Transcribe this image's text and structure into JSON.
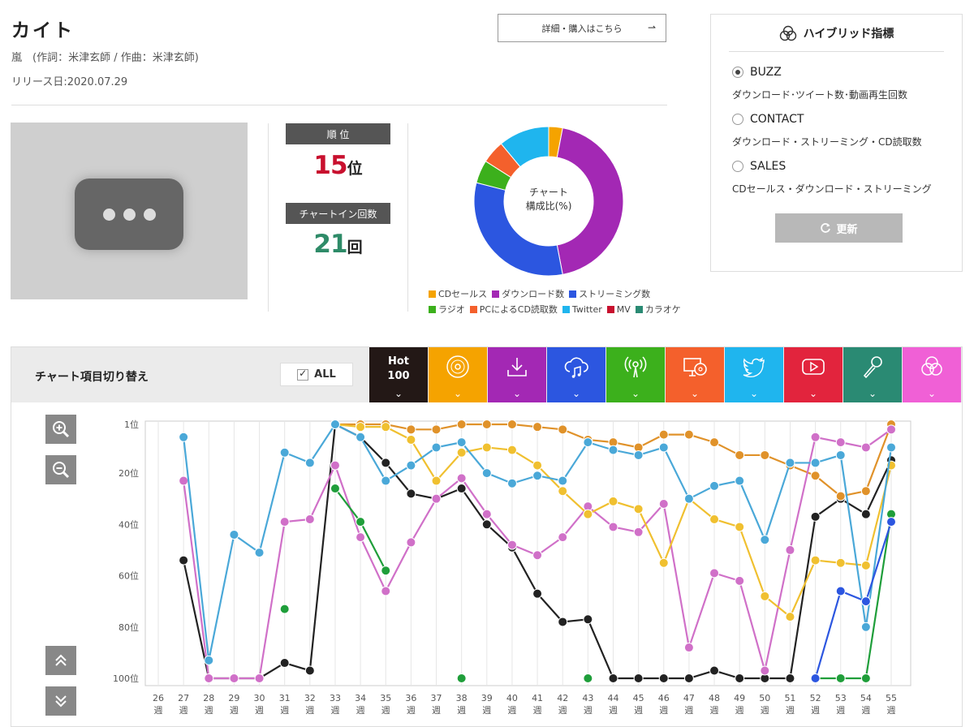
{
  "song": {
    "title": "カイト",
    "artist_line": "嵐　(作詞：米津玄師 / 作曲：米津玄師)",
    "release": "リリース日:2020.07.29"
  },
  "buy_button": {
    "label": "詳細・購入はこちら",
    "arrow": "⇀"
  },
  "rank": {
    "header": "順 位",
    "value": "15",
    "unit": "位"
  },
  "chart_in": {
    "header": "チャートイン回数",
    "value": "21",
    "unit": "回"
  },
  "donut": {
    "center_line1": "チャート",
    "center_line2": "構成比(%)"
  },
  "hybrid": {
    "title": "ハイブリッド指標",
    "options": [
      {
        "label": "BUZZ",
        "desc": "ダウンロード･ツイート数･動画再生回数",
        "selected": true
      },
      {
        "label": "CONTACT",
        "desc": "ダウンロード・ストリーミング・CD読取数",
        "selected": false
      },
      {
        "label": "SALES",
        "desc": "CDセールス・ダウンロード・ストリーミング",
        "selected": false
      }
    ],
    "update_label": "更新",
    "update_icon": "refresh-icon"
  },
  "switch_bar": {
    "label": "チャート項目切り替え",
    "all_label": "ALL",
    "hot100_line1": "Hot",
    "hot100_line2": "100",
    "chevron": "⌄",
    "tiles": [
      {
        "icon": "cd-icon",
        "color": "#f5a300"
      },
      {
        "icon": "download-icon",
        "color": "#a328b4"
      },
      {
        "icon": "cloud-music-icon",
        "color": "#2c56e0"
      },
      {
        "icon": "radio-icon",
        "color": "#3cb01c"
      },
      {
        "icon": "pc-cd-icon",
        "color": "#f4602c"
      },
      {
        "icon": "twitter-icon",
        "color": "#1fb5ee"
      },
      {
        "icon": "youtube-icon",
        "color": "#e2243d"
      },
      {
        "icon": "karaoke-icon",
        "color": "#2a8a73"
      },
      {
        "icon": "hybrid-icon",
        "color": "#f060d6"
      }
    ],
    "hot100_color": "#231816"
  },
  "chart_data": [
    {
      "type": "pie",
      "title": "チャート構成比(%)",
      "slices": [
        {
          "name": "CDセールス",
          "value": 3,
          "color": "#f5a300"
        },
        {
          "name": "ダウンロード数",
          "value": 44,
          "color": "#a328b4"
        },
        {
          "name": "ストリーミング数",
          "value": 32,
          "color": "#2c56e0"
        },
        {
          "name": "ラジオ",
          "value": 5,
          "color": "#3cb01c"
        },
        {
          "name": "PCによるCD読取数",
          "value": 5,
          "color": "#f4602c"
        },
        {
          "name": "Twitter",
          "value": 11,
          "color": "#1fb5ee"
        },
        {
          "name": "MV",
          "value": 0,
          "color": "#c8102e"
        },
        {
          "name": "カラオケ",
          "value": 0,
          "color": "#2a8a73"
        }
      ]
    },
    {
      "type": "line",
      "x": [
        "26",
        "27",
        "28",
        "29",
        "30",
        "31",
        "32",
        "33",
        "34",
        "35",
        "36",
        "37",
        "38",
        "39",
        "40",
        "41",
        "42",
        "43",
        "44",
        "45",
        "46",
        "47",
        "48",
        "49",
        "50",
        "51",
        "52",
        "53",
        "54",
        "55"
      ],
      "x_unit": "週",
      "y_ticks": [
        "1位",
        "20位",
        "40位",
        "60位",
        "80位",
        "100位"
      ],
      "y_tick_values": [
        1,
        20,
        40,
        60,
        80,
        100
      ],
      "ylim": [
        100,
        1
      ],
      "grid": true,
      "series": [
        {
          "name": "Hot 100",
          "color": "#222222",
          "values": [
            null,
            54,
            100,
            100,
            100,
            94,
            97,
            1,
            6,
            16,
            28,
            30,
            26,
            40,
            49,
            67,
            78,
            77,
            100,
            100,
            100,
            100,
            97,
            100,
            100,
            100,
            37,
            30,
            36,
            15
          ]
        },
        {
          "name": "CDセールス",
          "color": "#e0922a",
          "values": [
            null,
            null,
            null,
            null,
            null,
            null,
            null,
            1,
            1,
            1,
            3,
            3,
            1,
            1,
            1,
            2,
            3,
            7,
            8,
            10,
            5,
            5,
            8,
            13,
            13,
            17,
            21,
            29,
            27,
            1
          ]
        },
        {
          "name": "ダウンロード数",
          "color": "#d070c8",
          "values": [
            null,
            23,
            100,
            100,
            100,
            39,
            38,
            17,
            45,
            66,
            47,
            30,
            22,
            36,
            48,
            52,
            45,
            33,
            41,
            43,
            32,
            88,
            59,
            62,
            97,
            50,
            6,
            8,
            10,
            3
          ]
        },
        {
          "name": "ストリーミング数",
          "color": "#f0c030",
          "values": [
            null,
            null,
            null,
            null,
            null,
            null,
            null,
            1,
            2,
            2,
            7,
            23,
            12,
            10,
            11,
            17,
            27,
            36,
            31,
            34,
            55,
            30,
            38,
            41,
            68,
            76,
            54,
            55,
            56,
            17
          ]
        },
        {
          "name": "Twitter",
          "color": "#4aa8d8",
          "values": [
            null,
            6,
            93,
            44,
            51,
            12,
            16,
            1,
            6,
            23,
            17,
            10,
            8,
            20,
            24,
            21,
            23,
            8,
            11,
            13,
            10,
            30,
            25,
            23,
            46,
            16,
            16,
            13,
            80,
            10
          ]
        },
        {
          "name": "ラジオ",
          "color": "#1f9e3a",
          "values": [
            null,
            null,
            null,
            null,
            null,
            73,
            null,
            26,
            39,
            58,
            null,
            null,
            100,
            null,
            null,
            null,
            null,
            100,
            null,
            null,
            null,
            null,
            null,
            null,
            null,
            null,
            100,
            100,
            100,
            36
          ]
        },
        {
          "name": "PCによるCD読取数",
          "color": "#2c56e0",
          "values": [
            null,
            null,
            null,
            null,
            null,
            null,
            null,
            null,
            null,
            null,
            null,
            null,
            null,
            null,
            null,
            null,
            null,
            null,
            null,
            null,
            null,
            null,
            null,
            null,
            null,
            null,
            100,
            66,
            70,
            39
          ]
        }
      ]
    }
  ]
}
